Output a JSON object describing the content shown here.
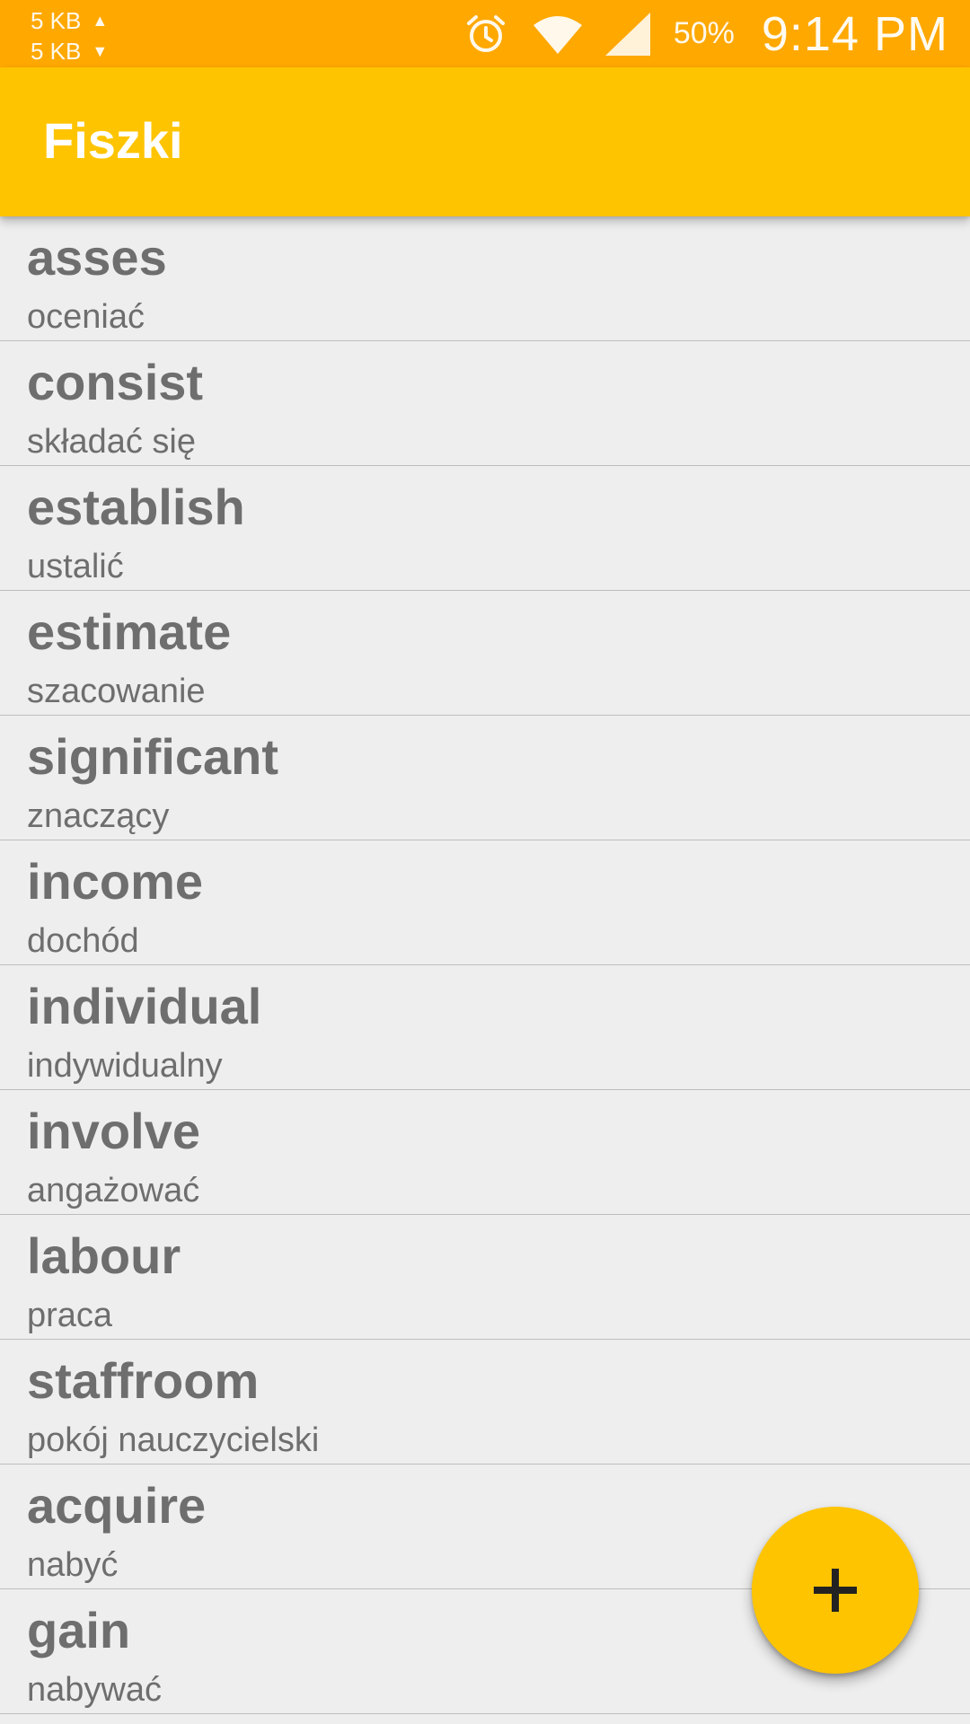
{
  "status_bar": {
    "upload_speed": "5 KB",
    "download_speed": "5 KB",
    "upload_arrow": "▲",
    "download_arrow": "▼",
    "battery": "50%",
    "time": "9:14 PM",
    "icons": [
      "alarm-icon",
      "wifi-icon",
      "signal-icon"
    ]
  },
  "app_bar": {
    "title": "Fiszki"
  },
  "words": [
    {
      "term": "asses",
      "translation": "oceniać"
    },
    {
      "term": "consist",
      "translation": "składać się"
    },
    {
      "term": "establish",
      "translation": "ustalić"
    },
    {
      "term": "estimate",
      "translation": "szacowanie"
    },
    {
      "term": "significant",
      "translation": "znaczący"
    },
    {
      "term": "income",
      "translation": "dochód"
    },
    {
      "term": "individual",
      "translation": "indywidualny"
    },
    {
      "term": "involve",
      "translation": "angażować"
    },
    {
      "term": "labour",
      "translation": "praca"
    },
    {
      "term": "staffroom",
      "translation": "pokój nauczycielski"
    },
    {
      "term": "acquire",
      "translation": "nabyć"
    },
    {
      "term": "gain",
      "translation": "nabywać"
    }
  ],
  "fab": {
    "icon": "plus-icon"
  },
  "colors": {
    "status_bar": "#ffa800",
    "primary": "#ffc400",
    "background": "#eeeeee",
    "text": "#6e6e6e"
  }
}
